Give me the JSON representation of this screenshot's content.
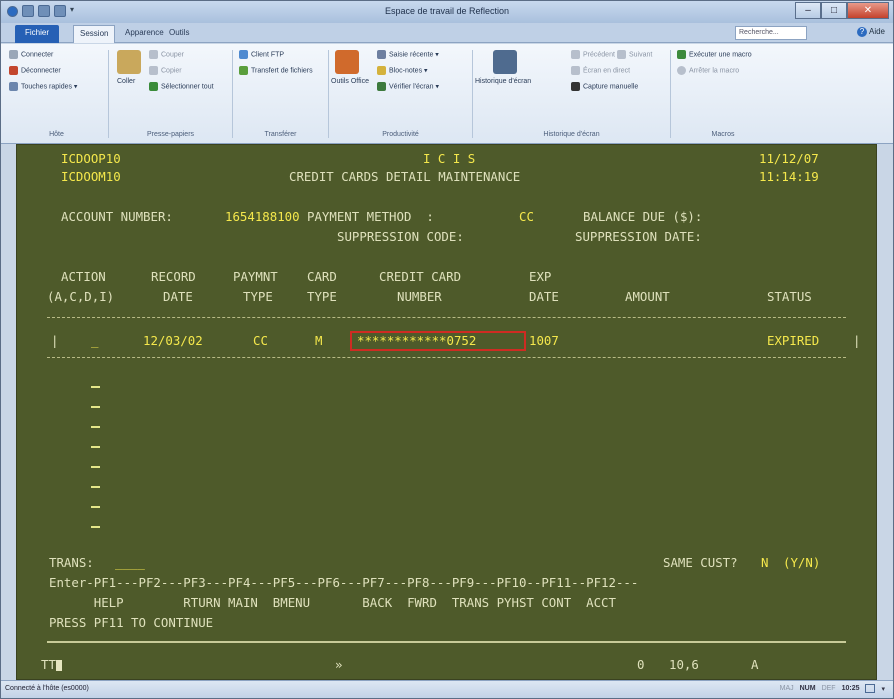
{
  "window": {
    "title": "Espace de travail de Reflection",
    "controls": {
      "minimize": "–",
      "maximize": "□",
      "close": "✕"
    }
  },
  "tabs": {
    "file": "Fichier",
    "items": [
      "Session",
      "Apparence",
      "Outils"
    ],
    "search_placeholder": "Recherche...",
    "help": "Aide"
  },
  "ribbon": {
    "groups": [
      {
        "label": "Hôte",
        "items": [
          "Connecter",
          "Déconnecter",
          "Touches rapides"
        ]
      },
      {
        "label": "Presse-papiers",
        "items": [
          "Coller",
          "Couper",
          "Copier",
          "Sélectionner tout"
        ]
      },
      {
        "label": "Transférer",
        "items": [
          "Client FTP",
          "Transfert de fichiers"
        ]
      },
      {
        "label": "Productivité",
        "items": [
          "Outils Office",
          "Saisie récente",
          "Bloc-notes",
          "Vérifier l'écran"
        ]
      },
      {
        "label": "Historique d'écran",
        "items": [
          "Historique d'écran",
          "Précédent",
          "Suivant",
          "Écran en direct",
          "Capture manuelle"
        ]
      },
      {
        "label": "Macros",
        "items": [
          "Exécuter une macro",
          "Arrêter la macro"
        ]
      }
    ]
  },
  "terminal": {
    "prog1": "ICDOOP10",
    "app": "I C I S",
    "date": "11/12/07",
    "prog2": "ICDOOM10",
    "screen_title": "CREDIT CARDS DETAIL MAINTENANCE",
    "time": "11:14:19",
    "account_label": "ACCOUNT NUMBER:",
    "account_number": "1654188100",
    "payment_method_label": "PAYMENT METHOD  :",
    "payment_method": "CC",
    "balance_label": "BALANCE DUE ($):",
    "suppression_code_label": "SUPPRESSION CODE:",
    "suppression_date_label": "SUPPRESSION DATE:",
    "headers": {
      "action": "ACTION",
      "action2": "(A,C,D,I)",
      "record": "RECORD",
      "record2": "DATE",
      "paymnt": "PAYMNT",
      "paymnt2": "TYPE",
      "card": "CARD",
      "card2": "TYPE",
      "cc": "CREDIT CARD",
      "cc2": "NUMBER",
      "exp": "EXP",
      "exp2": "DATE",
      "amount": "AMOUNT",
      "status": "STATUS"
    },
    "row": {
      "action": "_",
      "record_date": "12/03/02",
      "payment_type": "CC",
      "card_type": "M",
      "card_number": "************0752",
      "exp_date": "1007",
      "amount": "",
      "status": "EXPIRED"
    },
    "trans_label": "TRANS:",
    "trans_value": "____",
    "same_cust_label": "SAME CUST?",
    "same_cust_value": "N",
    "same_cust_opts": "(Y/N)",
    "pf_line": "Enter-PF1---PF2---PF3---PF4---PF5---PF6---PF7---PF8---PF9---PF10--PF11--PF12---",
    "pf_labels": "      HELP        RTURN MAIN  BMENU       BACK  FWRD  TRANS PYHST CONT  ACCT",
    "message": "PRESS PF11 TO CONTINUE",
    "oia_left": "TT",
    "oia_mid": "»",
    "oia_o": "0",
    "oia_pos": "10,6",
    "oia_a": "A"
  },
  "status_bar": {
    "connection": "Connecté à l'hôte (es0000)",
    "maj": "MAJ",
    "num": "NUM",
    "def": "DEF",
    "clock": "10:25"
  }
}
